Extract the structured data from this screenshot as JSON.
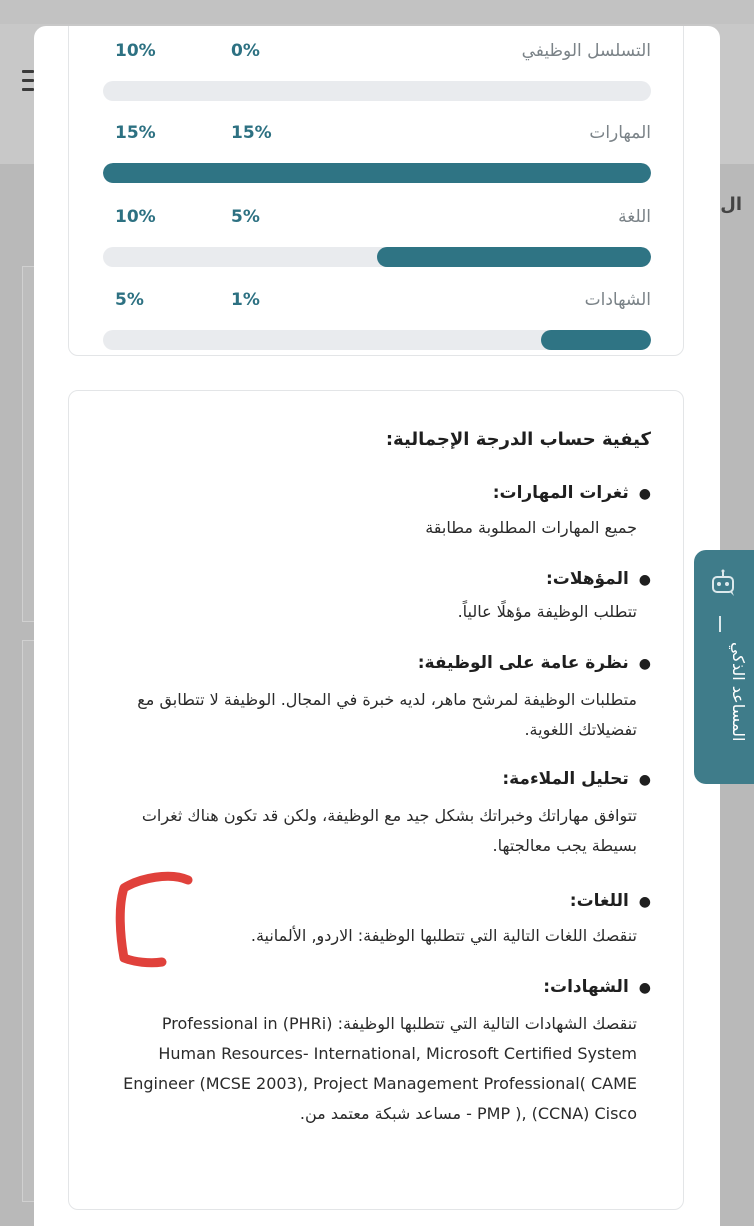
{
  "metrics": [
    {
      "label": "التسلسل الوظيفي",
      "v1": "10%",
      "v2": "0%",
      "fill": 0
    },
    {
      "label": "المهارات",
      "v1": "15%",
      "v2": "15%",
      "fill": 1.0
    },
    {
      "label": "اللغة",
      "v1": "10%",
      "v2": "5%",
      "fill": 0.5
    },
    {
      "label": "الشهادات",
      "v1": "5%",
      "v2": "1%",
      "fill": 0.2
    }
  ],
  "explanation": {
    "heading": "كيفية حساب الدرجة الإجمالية:",
    "sections": [
      {
        "title": "ثغرات المهارات:",
        "body": "جميع المهارات المطلوبة مطابقة"
      },
      {
        "title": "المؤهلات:",
        "body": "تتطلب الوظيفة مؤهلًا عالياً."
      },
      {
        "title": "نظرة عامة على الوظيفة:",
        "body": "متطلبات الوظيفة لمرشح ماهر، لديه خبرة في المجال. الوظيفة لا تتطابق مع تفضيلاتك اللغوية."
      },
      {
        "title": "تحليل الملاءمة:",
        "body": "تتوافق مهاراتك وخبراتك بشكل جيد مع الوظيفة، ولكن قد تكون هناك ثغرات بسيطة يجب معالجتها."
      },
      {
        "title": "اللغات:",
        "body": "تنقصك اللغات التالية التي تتطلبها الوظيفة: الاردو, الألمانية."
      },
      {
        "title": "الشهادات:",
        "body": "تنقصك الشهادات التالية التي تتطلبها الوظيفة: (PHRi) Professional in Human Resources- International, Microsoft Certified System Engineer (MCSE 2003), Project Management Professional( CAME - PMP ), (CCNA) Cisco مساعد شبكة معتمد من."
      }
    ]
  },
  "assistant": {
    "label": "المساعد الذكي",
    "icon": "robot-icon"
  },
  "colors": {
    "accent": "#2f7484",
    "track": "#e9ebee",
    "annotation": "#e0413b"
  }
}
